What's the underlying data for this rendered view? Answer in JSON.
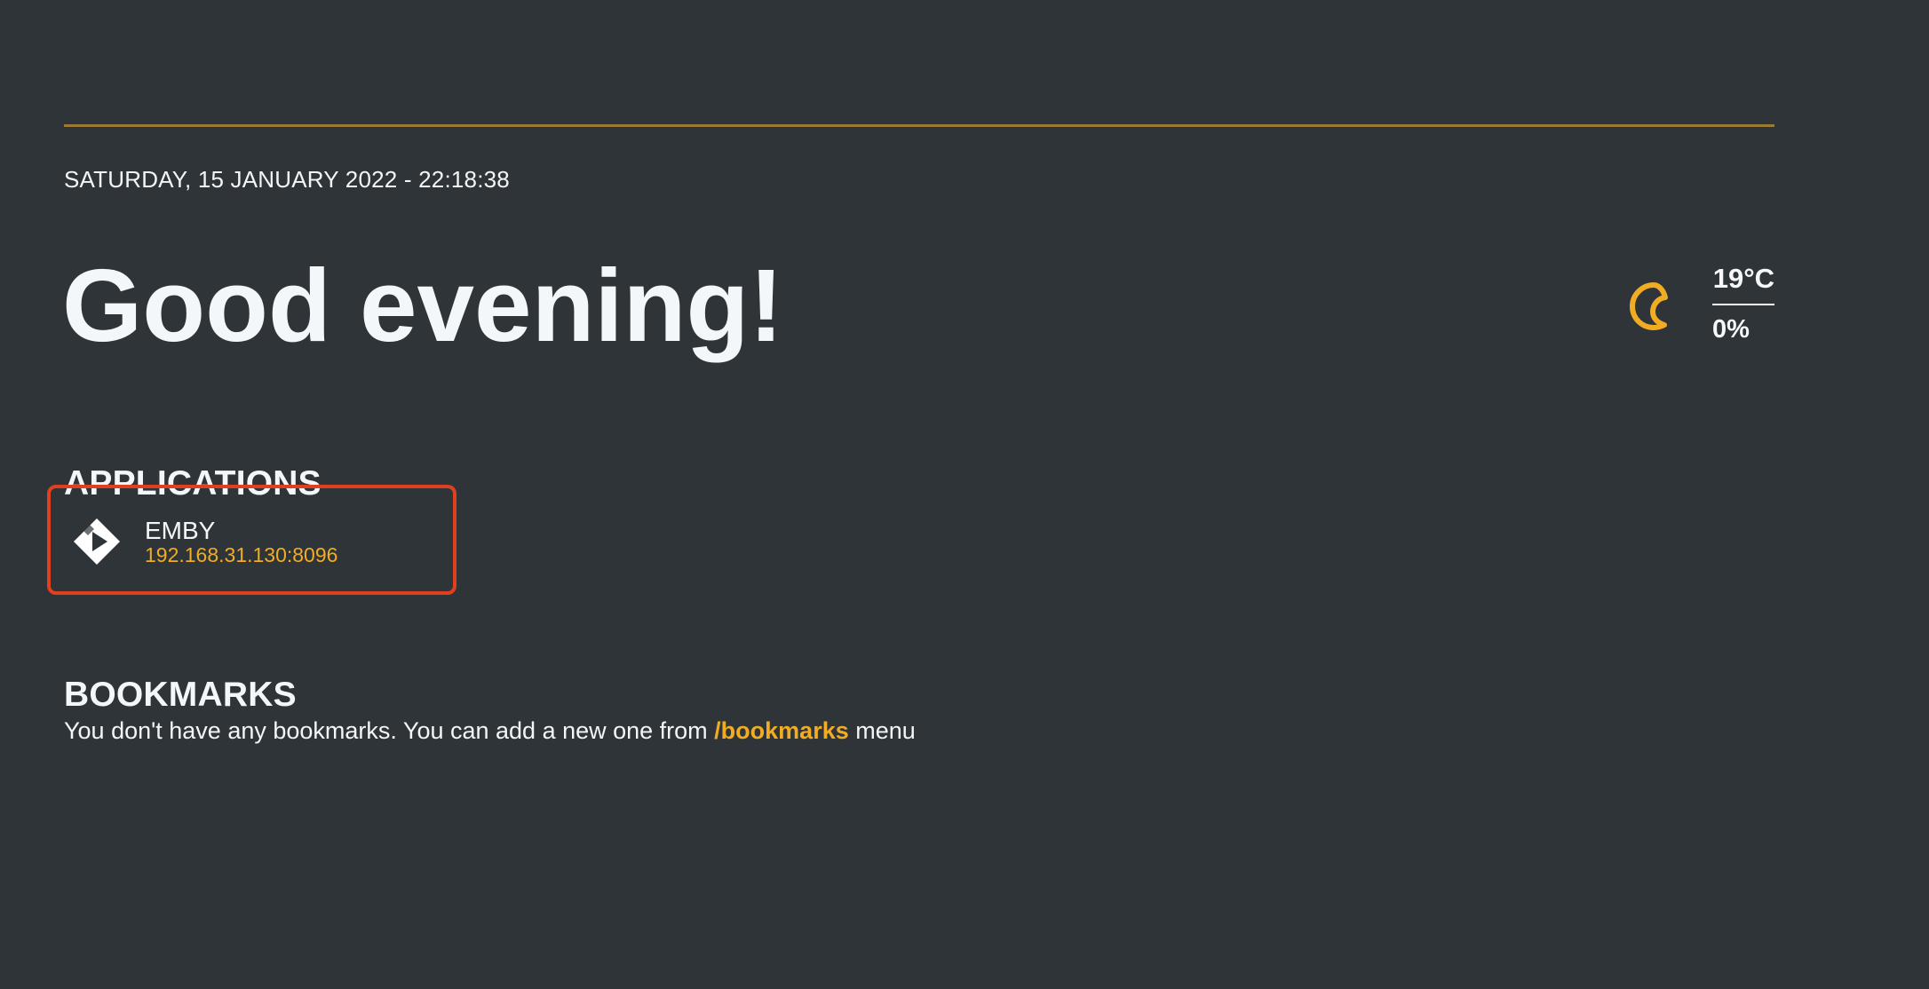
{
  "header": {
    "datetime": "SATURDAY, 15 JANUARY 2022 - 22:18:38",
    "greeting": "Good evening!"
  },
  "weather": {
    "icon": "moon-icon",
    "temperature": "19°C",
    "humidity": "0%"
  },
  "applications": {
    "title": "APPLICATIONS",
    "items": [
      {
        "name": "EMBY",
        "url": "192.168.31.130:8096",
        "icon": "emby-icon"
      }
    ]
  },
  "bookmarks": {
    "title": "BOOKMARKS",
    "empty_text_before": "You don't have any bookmarks. You can add a new one from ",
    "link_label": "/bookmarks",
    "empty_text_after": " menu"
  },
  "colors": {
    "background": "#2f3438",
    "accent": "#f0ad24",
    "rule": "#9b7a35",
    "selection_border": "#e0401d"
  }
}
